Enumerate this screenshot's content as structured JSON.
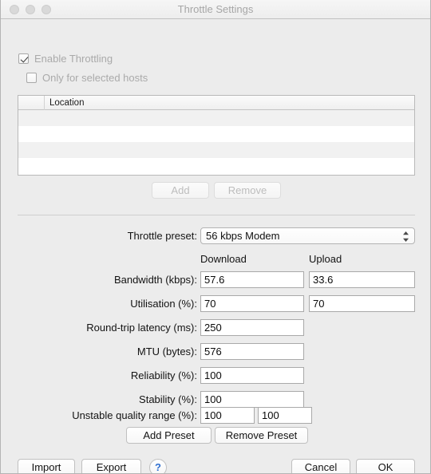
{
  "window": {
    "title": "Throttle Settings",
    "traffic_lights": [
      "close",
      "minimize",
      "zoom"
    ]
  },
  "options": {
    "enable_throttling": {
      "label": "Enable Throttling",
      "checked": true,
      "disabled": true
    },
    "only_selected_hosts": {
      "label": "Only for selected hosts",
      "checked": false,
      "disabled": true
    }
  },
  "location_table": {
    "columns": [
      "",
      "Location"
    ],
    "rows": [
      "",
      "",
      "",
      ""
    ],
    "add_label": "Add",
    "remove_label": "Remove",
    "add_enabled": false,
    "remove_enabled": false
  },
  "form": {
    "preset_label": "Throttle preset:",
    "preset_value": "56 kbps Modem",
    "column_headers": {
      "download": "Download",
      "upload": "Upload"
    },
    "fields": [
      {
        "label": "Bandwidth (kbps):",
        "download": "57.6",
        "upload": "33.6"
      },
      {
        "label": "Utilisation (%):",
        "download": "70",
        "upload": "70"
      },
      {
        "label": "Round-trip latency (ms):",
        "download": "250"
      },
      {
        "label": "MTU (bytes):",
        "download": "576"
      },
      {
        "label": "Reliability (%):",
        "download": "100"
      },
      {
        "label": "Stability (%):",
        "download": "100"
      },
      {
        "label": "Unstable quality range (%):",
        "download": "100",
        "upload": "100"
      }
    ]
  },
  "preset_buttons": {
    "add_preset": "Add Preset",
    "remove_preset": "Remove Preset"
  },
  "footer": {
    "import": "Import",
    "export": "Export",
    "help": "?",
    "cancel": "Cancel",
    "ok": "OK"
  },
  "colors": {
    "window_background": "#ececec",
    "titlebar": "#f0f0f0",
    "title_text": "#a6a6a6",
    "disabled_text": "#aaaaaa",
    "field_border": "#a9a9a9",
    "row_stripe": "#f1f1f1",
    "help_blue": "#2f6fd0"
  }
}
